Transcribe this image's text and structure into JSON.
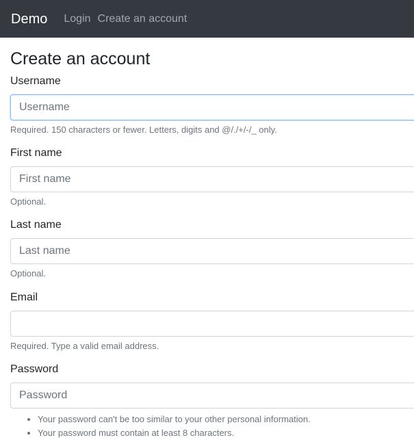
{
  "navbar": {
    "brand": "Demo",
    "links": [
      "Login",
      "Create an account"
    ]
  },
  "page": {
    "title": "Create an account"
  },
  "form": {
    "username": {
      "label": "Username",
      "placeholder": "Username",
      "value": "",
      "help": "Required. 150 characters or fewer. Letters, digits and @/./+/-/_ only."
    },
    "first_name": {
      "label": "First name",
      "placeholder": "First name",
      "value": "",
      "help": "Optional."
    },
    "last_name": {
      "label": "Last name",
      "placeholder": "Last name",
      "value": "",
      "help": "Optional."
    },
    "email": {
      "label": "Email",
      "placeholder": "",
      "value": "",
      "help": "Required. Type a valid email address."
    },
    "password": {
      "label": "Password",
      "placeholder": "Password",
      "value": "",
      "help_items": [
        "Your password can't be too similar to your other personal information.",
        "Your password must contain at least 8 characters."
      ]
    }
  },
  "colors": {
    "navbar_bg": "#343a40",
    "focus_border": "#80bdff",
    "help_text": "#6c757d"
  }
}
